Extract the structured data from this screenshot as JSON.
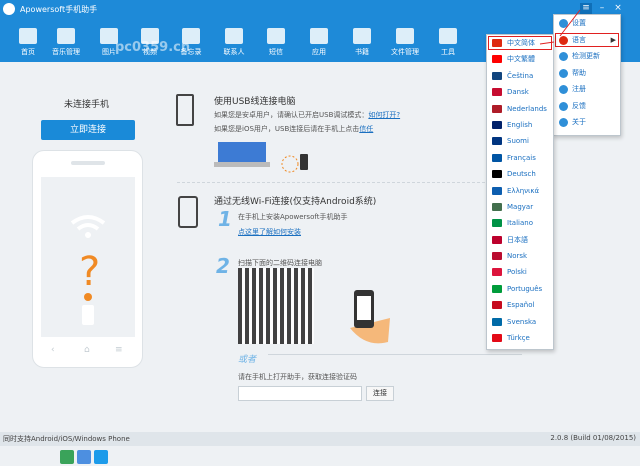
{
  "app": {
    "title": "Apowersoft手机助手",
    "watermark": "pc0359.cn"
  },
  "nav": [
    {
      "label": "首页",
      "icon": "home-icon"
    },
    {
      "label": "音乐管理",
      "icon": "music-icon"
    },
    {
      "label": "图片",
      "icon": "photo-icon"
    },
    {
      "label": "视频",
      "icon": "video-icon"
    },
    {
      "label": "备忘录",
      "icon": "memo-icon"
    },
    {
      "label": "联系人",
      "icon": "contacts-icon"
    },
    {
      "label": "短信",
      "icon": "sms-icon"
    },
    {
      "label": "应用",
      "icon": "apps-icon"
    },
    {
      "label": "书籍",
      "icon": "book-icon"
    },
    {
      "label": "文件管理",
      "icon": "file-manager-icon"
    },
    {
      "label": "工具",
      "icon": "tools-icon"
    }
  ],
  "left": {
    "status": "未连接手机",
    "connect_button": "立即连接",
    "platform_icons": [
      "android-icon",
      "apple-icon",
      "windows-icon"
    ]
  },
  "usb": {
    "title": "使用USB线连接电脑",
    "line1": "如果您是安卓用户，请确认已开启USB调试模式：",
    "line1_link": "如何打开?",
    "line2": "如果您是iOS用户，USB连接后请在手机上点击",
    "line2_link": "信任"
  },
  "wifi": {
    "title": "通过无线Wi-Fi连接(仅支持Android系统)",
    "step1_num": "1",
    "step1_text": "在手机上安装Apowersoft手机助手",
    "step1_link": "点这里了解如何安装",
    "step2_num": "2",
    "step2_text": "扫描下面的二维码连接电脑",
    "or_label": "或者",
    "code_prompt": "请在手机上打开助手，获取连接验证码",
    "code_input_placeholder": "",
    "code_button": "连接"
  },
  "footer": {
    "left": "同时支持Android/iOS/Windows Phone",
    "right": "2.0.8 (Build 01/08/2015)"
  },
  "settings_menu": [
    {
      "label": "设置",
      "icon": "gear-icon",
      "color": "#2f8fd8"
    },
    {
      "label": "语言",
      "icon": "china-flag-icon",
      "color": "#de2910",
      "selected": true
    },
    {
      "label": "检测更新",
      "icon": "refresh-icon",
      "color": "#2f8fd8"
    },
    {
      "label": "帮助",
      "icon": "help-icon",
      "color": "#2f8fd8"
    },
    {
      "label": "注册",
      "icon": "register-icon",
      "color": "#2f8fd8"
    },
    {
      "label": "反馈",
      "icon": "feedback-icon",
      "color": "#2f8fd8"
    },
    {
      "label": "关于",
      "icon": "info-icon",
      "color": "#2f8fd8"
    }
  ],
  "languages": [
    {
      "label": "中文简体",
      "flag": "#de2910",
      "selected": true
    },
    {
      "label": "中文繁體",
      "flag": "#fe0000"
    },
    {
      "label": "Čeština",
      "flag": "#11457e"
    },
    {
      "label": "Dansk",
      "flag": "#c60c30"
    },
    {
      "label": "Nederlands",
      "flag": "#ae1c28"
    },
    {
      "label": "English",
      "flag": "#012169"
    },
    {
      "label": "Suomi",
      "flag": "#003580"
    },
    {
      "label": "Français",
      "flag": "#0055a4"
    },
    {
      "label": "Deutsch",
      "flag": "#000000"
    },
    {
      "label": "Ελληνικά",
      "flag": "#0d5eaf"
    },
    {
      "label": "Magyar",
      "flag": "#436f4d"
    },
    {
      "label": "Italiano",
      "flag": "#009246"
    },
    {
      "label": "日本語",
      "flag": "#bc002d"
    },
    {
      "label": "Norsk",
      "flag": "#ba0c2f"
    },
    {
      "label": "Polski",
      "flag": "#dc143c"
    },
    {
      "label": "Português",
      "flag": "#009c3b"
    },
    {
      "label": "Español",
      "flag": "#c60b1e"
    },
    {
      "label": "Svenska",
      "flag": "#006aa7"
    },
    {
      "label": "Türkçe",
      "flag": "#e30a17"
    }
  ],
  "colors": {
    "topbar": "#1e8ad8",
    "accent": "#1a8ad8",
    "link": "#1a6fc0",
    "highlight": "#e02020"
  }
}
